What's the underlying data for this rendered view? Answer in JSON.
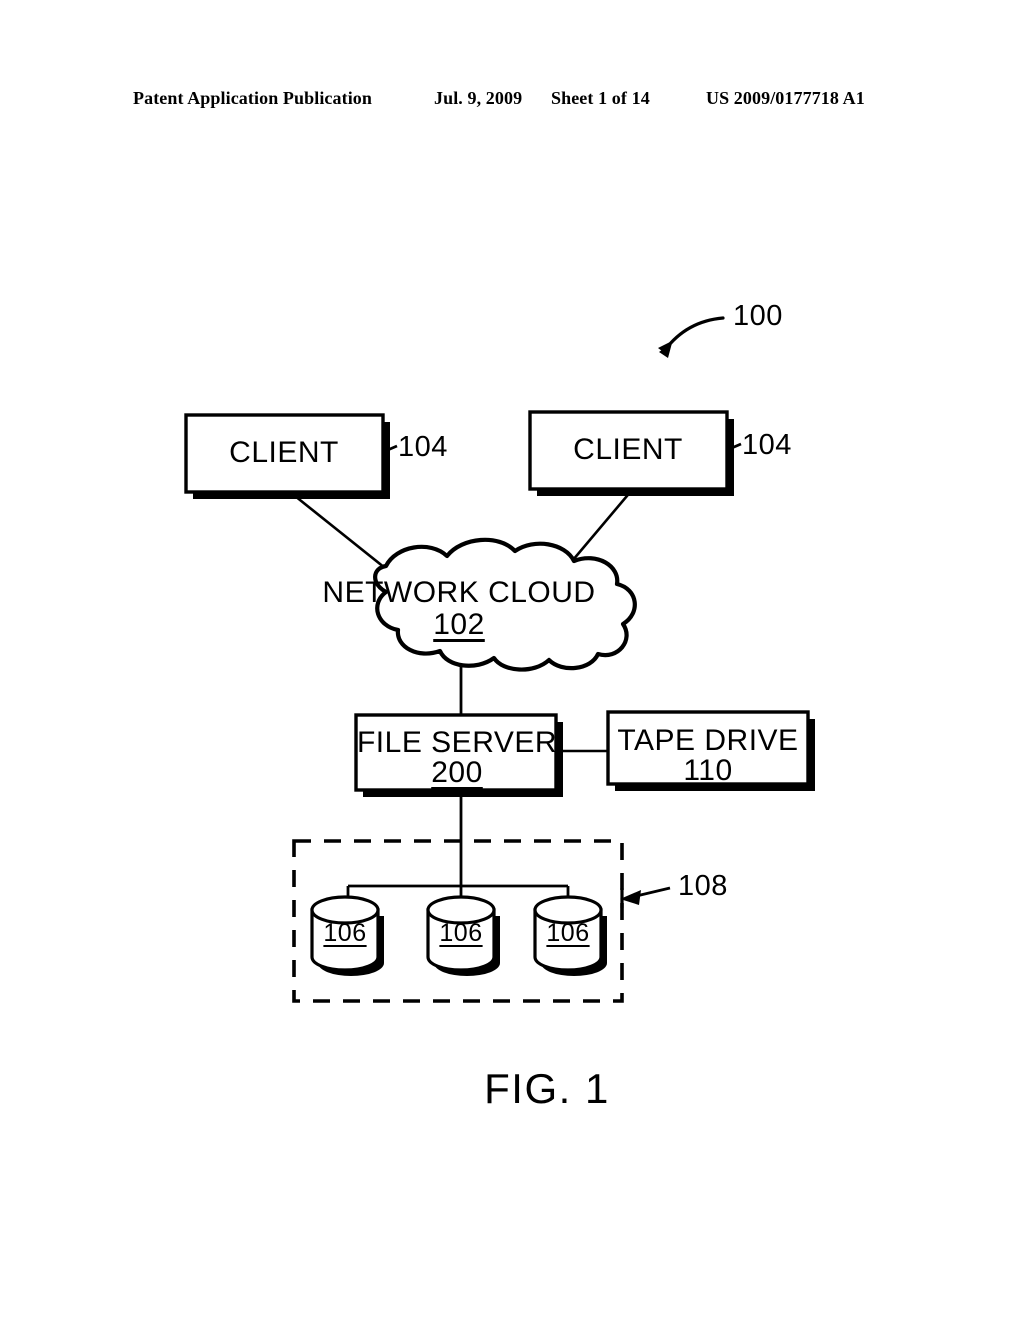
{
  "header": {
    "publication": "Patent Application Publication",
    "date": "Jul. 9, 2009",
    "sheet": "Sheet 1 of 14",
    "patent_number": "US 2009/0177718 A1"
  },
  "figure": {
    "caption": "FIG. 1",
    "system_ref": "100",
    "nodes": {
      "client_left": {
        "label": "CLIENT",
        "ref": "104"
      },
      "client_right": {
        "label": "CLIENT",
        "ref": "104"
      },
      "network_cloud": {
        "label": "NETWORK CLOUD",
        "ref": "102"
      },
      "file_server": {
        "label": "FILE SERVER",
        "ref": "200"
      },
      "tape_drive": {
        "label": "TAPE DRIVE",
        "ref": "110"
      },
      "disk_array": {
        "ref": "108"
      },
      "disks": [
        {
          "ref": "106"
        },
        {
          "ref": "106"
        },
        {
          "ref": "106"
        }
      ]
    }
  },
  "colors": {
    "ink": "#000000",
    "paper": "#ffffff"
  }
}
